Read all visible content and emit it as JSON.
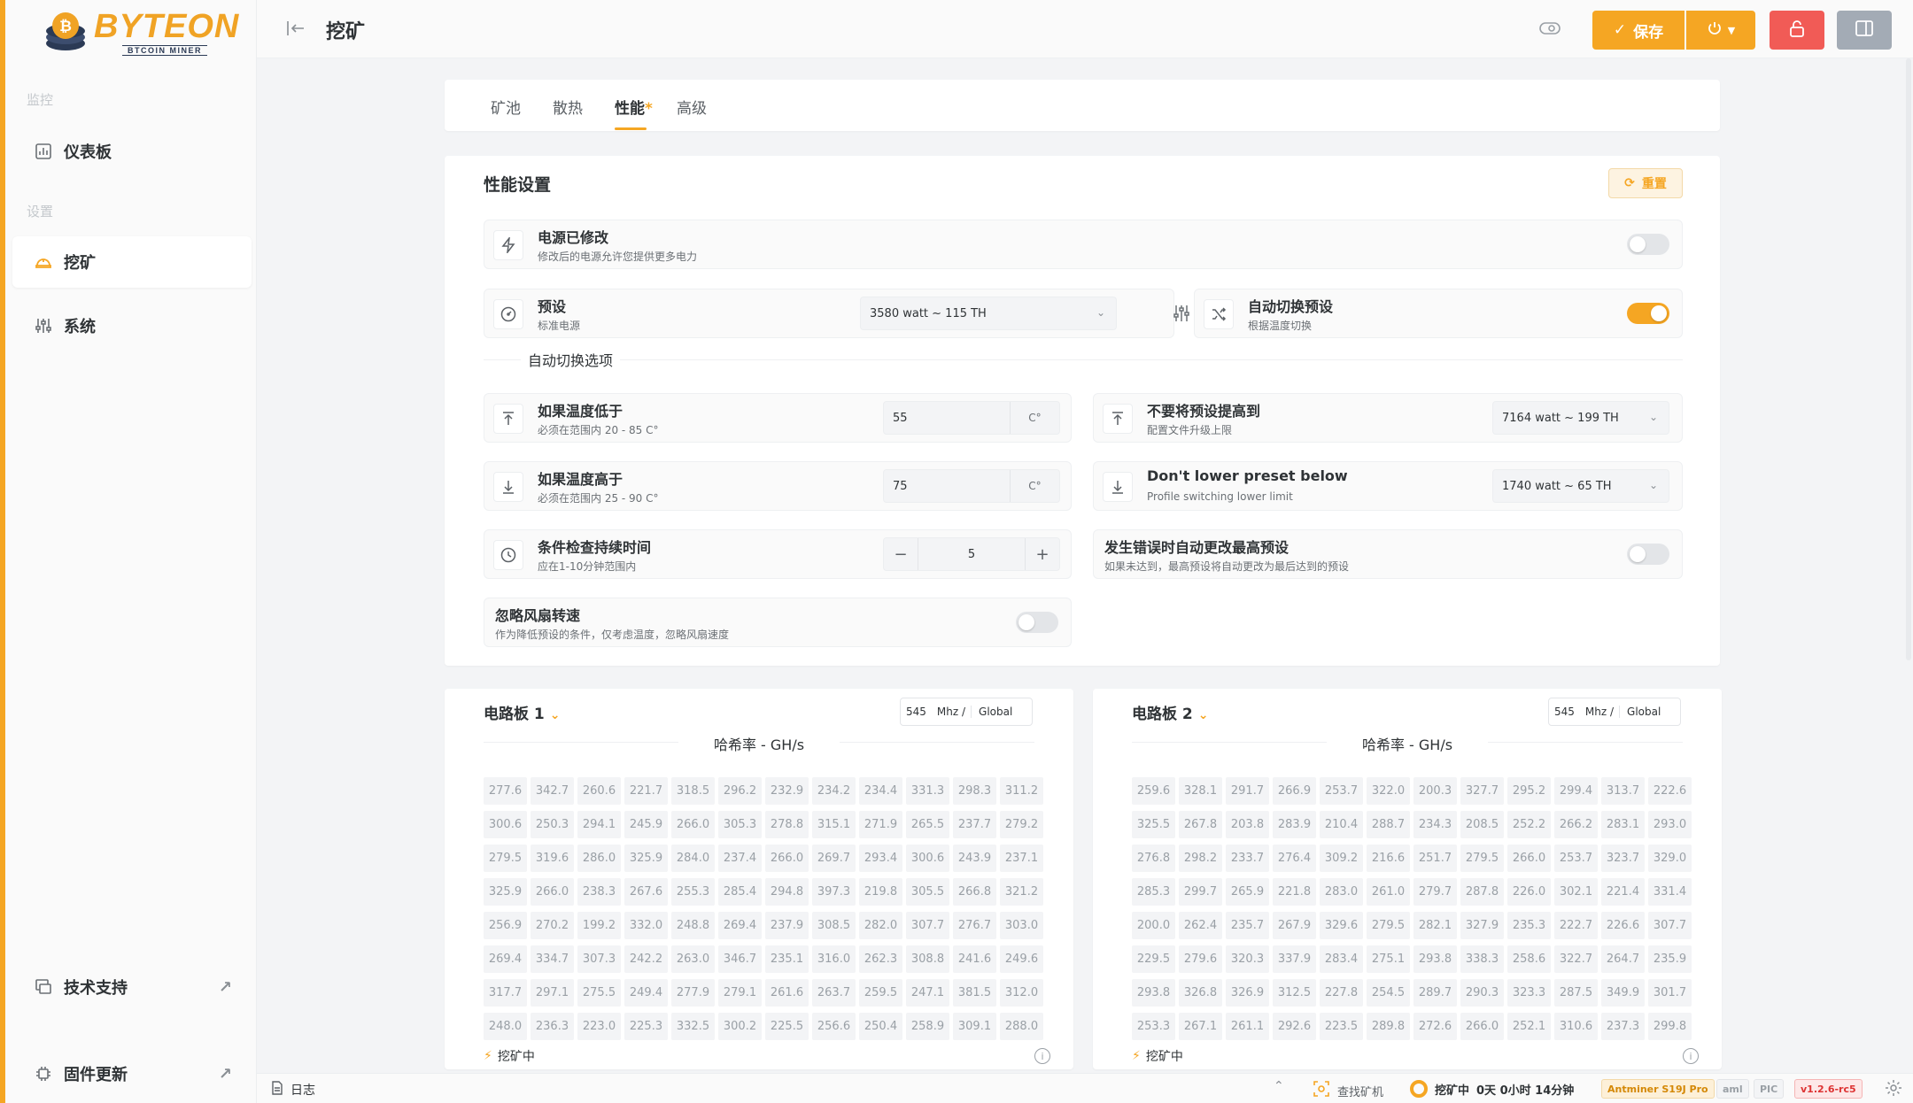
{
  "brand": {
    "name": "BYTEON",
    "tagline": "BTCOIN MINER"
  },
  "sidebar": {
    "section_monitor": "监控",
    "section_settings": "设置",
    "items": [
      {
        "label": "仪表板",
        "icon": "chart-icon"
      },
      {
        "label": "挖矿",
        "icon": "hardhat-icon",
        "active": true
      },
      {
        "label": "系统",
        "icon": "sliders-icon"
      }
    ],
    "bottom": [
      {
        "label": "技术支持",
        "icon": "support-icon"
      },
      {
        "label": "固件更新",
        "icon": "chip-icon"
      }
    ]
  },
  "header": {
    "title": "挖矿",
    "save_label": "保存"
  },
  "tabs": [
    {
      "label": "矿池"
    },
    {
      "label": "散热"
    },
    {
      "label": "性能",
      "mark": "*",
      "active": true
    },
    {
      "label": "高级"
    }
  ],
  "perf": {
    "title": "性能设置",
    "reset_label": "重置",
    "psu_modified": {
      "title": "电源已修改",
      "subtitle": "修改后的电源允许您提供更多电力",
      "enabled": false
    },
    "preset": {
      "title": "预设",
      "subtitle": "标准电源",
      "value": "3580 watt ~ 115 TH"
    },
    "auto_switch": {
      "title": "自动切换预设",
      "subtitle": "根据温度切换",
      "enabled": true
    },
    "auto_options_label": "自动切换选项",
    "temp_below": {
      "title": "如果温度低于",
      "subtitle": "必须在范围内 20 - 85 C°",
      "value": "55",
      "unit": "C°"
    },
    "max_preset": {
      "title": "不要将预设提高到",
      "subtitle": "配置文件升级上限",
      "value": "7164 watt ~ 199 TH"
    },
    "temp_above": {
      "title": "如果温度高于",
      "subtitle": "必须在范围内 25 - 90 C°",
      "value": "75",
      "unit": "C°"
    },
    "min_preset": {
      "title": "Don't lower preset below",
      "subtitle": "Profile switching lower limit",
      "value": "1740 watt ~ 65 TH"
    },
    "check_duration": {
      "title": "条件检查持续时间",
      "subtitle": "应在1-10分钟范围内",
      "value": "5",
      "minus": "−",
      "plus": "+"
    },
    "on_error": {
      "title": "发生错误时自动更改最高预设",
      "subtitle": "如果未达到，最高预设将自动更改为最后达到的预设",
      "enabled": false
    },
    "ignore_fan": {
      "title": "忽略风扇转速",
      "subtitle": "作为降低预设的条件，仅考虑温度，忽略风扇速度",
      "enabled": false
    }
  },
  "boards": [
    {
      "title": "电路板 1",
      "freq": "545",
      "freq_unit": "Mhz /",
      "freq_mode": "Global",
      "hashrate_title": "哈希率 - GH/s",
      "status": "挖矿中",
      "values": [
        [
          "277.6",
          "342.7",
          "260.6",
          "221.7",
          "318.5",
          "296.2",
          "232.9",
          "234.2",
          "234.4",
          "331.3",
          "298.3",
          "311.2"
        ],
        [
          "300.6",
          "250.3",
          "294.1",
          "245.9",
          "266.0",
          "305.3",
          "278.8",
          "315.1",
          "271.9",
          "265.5",
          "237.7",
          "279.2"
        ],
        [
          "279.5",
          "319.6",
          "286.0",
          "325.9",
          "284.0",
          "237.4",
          "266.0",
          "269.7",
          "293.4",
          "300.6",
          "243.9",
          "237.1"
        ],
        [
          "325.9",
          "266.0",
          "238.3",
          "267.6",
          "255.3",
          "285.4",
          "294.8",
          "397.3",
          "219.8",
          "305.5",
          "266.8",
          "321.2"
        ],
        [
          "256.9",
          "270.2",
          "199.2",
          "332.0",
          "248.8",
          "269.4",
          "237.9",
          "308.5",
          "282.0",
          "307.7",
          "276.7",
          "303.0"
        ],
        [
          "269.4",
          "334.7",
          "307.3",
          "242.2",
          "263.0",
          "346.7",
          "235.1",
          "316.0",
          "262.3",
          "308.8",
          "241.6",
          "249.6"
        ],
        [
          "317.7",
          "297.1",
          "275.5",
          "249.4",
          "277.9",
          "279.1",
          "261.6",
          "263.7",
          "259.5",
          "247.1",
          "381.5",
          "312.0"
        ],
        [
          "248.0",
          "236.3",
          "223.0",
          "225.3",
          "332.5",
          "300.2",
          "225.5",
          "256.6",
          "250.4",
          "258.9",
          "309.1",
          "288.0"
        ]
      ]
    },
    {
      "title": "电路板 2",
      "freq": "545",
      "freq_unit": "Mhz /",
      "freq_mode": "Global",
      "hashrate_title": "哈希率 - GH/s",
      "status": "挖矿中",
      "values": [
        [
          "259.6",
          "328.1",
          "291.7",
          "266.9",
          "253.7",
          "322.0",
          "200.3",
          "327.7",
          "295.2",
          "299.4",
          "313.7",
          "222.6"
        ],
        [
          "325.5",
          "267.8",
          "203.8",
          "283.9",
          "210.4",
          "288.7",
          "234.3",
          "208.5",
          "252.2",
          "266.2",
          "283.1",
          "293.0"
        ],
        [
          "276.8",
          "298.2",
          "233.7",
          "276.4",
          "309.2",
          "216.6",
          "251.7",
          "279.5",
          "266.0",
          "253.7",
          "323.7",
          "329.0"
        ],
        [
          "285.3",
          "299.7",
          "265.9",
          "221.8",
          "283.0",
          "261.0",
          "279.7",
          "287.8",
          "226.0",
          "302.1",
          "221.4",
          "331.4"
        ],
        [
          "200.0",
          "262.4",
          "235.7",
          "267.9",
          "329.6",
          "279.5",
          "282.1",
          "327.9",
          "235.3",
          "222.7",
          "226.6",
          "307.7"
        ],
        [
          "229.5",
          "279.6",
          "320.3",
          "337.9",
          "283.4",
          "275.1",
          "293.8",
          "338.3",
          "258.6",
          "322.7",
          "264.7",
          "235.9"
        ],
        [
          "293.8",
          "326.8",
          "326.9",
          "312.5",
          "227.8",
          "254.5",
          "289.7",
          "290.3",
          "323.3",
          "287.5",
          "349.9",
          "301.7"
        ],
        [
          "253.3",
          "267.1",
          "261.1",
          "292.6",
          "223.5",
          "289.8",
          "272.6",
          "266.0",
          "252.1",
          "310.6",
          "237.3",
          "299.8"
        ]
      ]
    }
  ],
  "statusbar": {
    "log_label": "日志",
    "find_label": "查找矿机",
    "mining_label": "挖矿中",
    "uptime": "0天 0小时 14分钟",
    "model": "Antminer S19J Pro",
    "aml": "aml",
    "pic": "PIC",
    "version": "v1.2.6-rc5"
  },
  "colors": {
    "accent": "#f5a623",
    "danger": "#f15b56",
    "muted_button": "#a3abb5"
  }
}
